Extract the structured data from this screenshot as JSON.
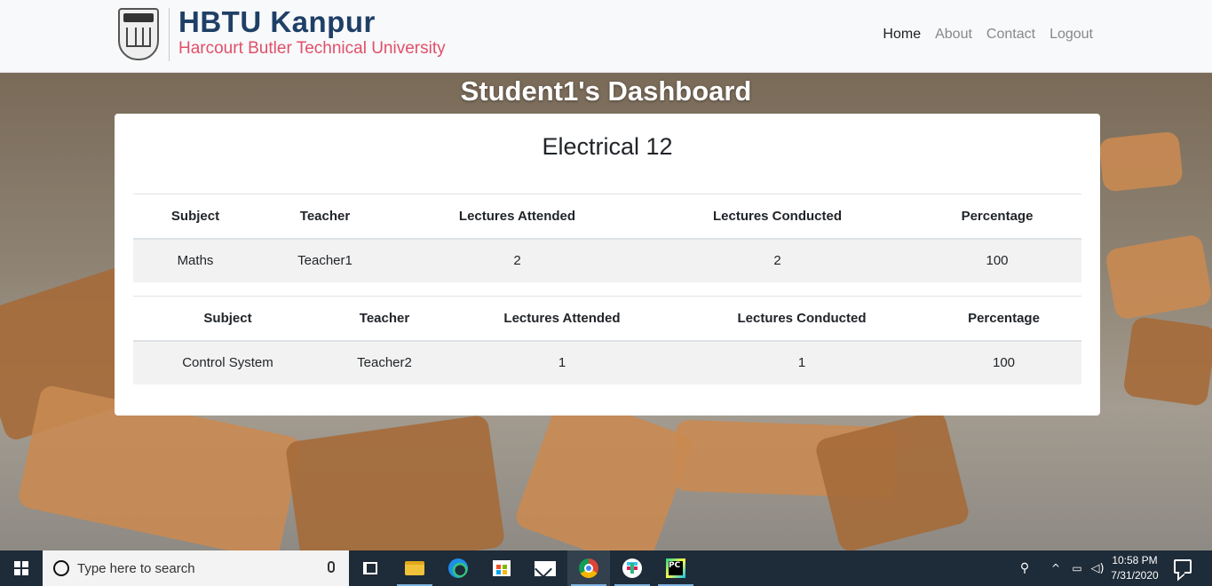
{
  "brand": {
    "title": "HBTU Kanpur",
    "subtitle": "Harcourt Butler Technical  University"
  },
  "nav": {
    "items": [
      {
        "label": "Home",
        "active": true
      },
      {
        "label": "About",
        "active": false
      },
      {
        "label": "Contact",
        "active": false
      },
      {
        "label": "Logout",
        "active": false
      }
    ]
  },
  "dashboard": {
    "title": "Student1's Dashboard",
    "class_name": "Electrical 12",
    "tables": [
      {
        "headers": [
          "Subject",
          "Teacher",
          "Lectures Attended",
          "Lectures Conducted",
          "Percentage"
        ],
        "rows": [
          [
            "Maths",
            "Teacher1",
            "2",
            "2",
            "100"
          ]
        ]
      },
      {
        "headers": [
          "Subject",
          "Teacher",
          "Lectures Attended",
          "Lectures Conducted",
          "Percentage"
        ],
        "rows": [
          [
            "Control System",
            "Teacher2",
            "1",
            "1",
            "100"
          ]
        ]
      }
    ]
  },
  "taskbar": {
    "search_placeholder": "Type here to search",
    "apps": [
      "task-view",
      "file-explorer",
      "edge",
      "store",
      "mail",
      "chrome",
      "slack",
      "pycharm"
    ],
    "active_app": "chrome",
    "time": "10:58 PM",
    "date": "7/31/2020"
  },
  "colors": {
    "brand_title": "#1f3f66",
    "brand_subtitle": "#e0506a",
    "taskbar": "#1e2b38"
  }
}
